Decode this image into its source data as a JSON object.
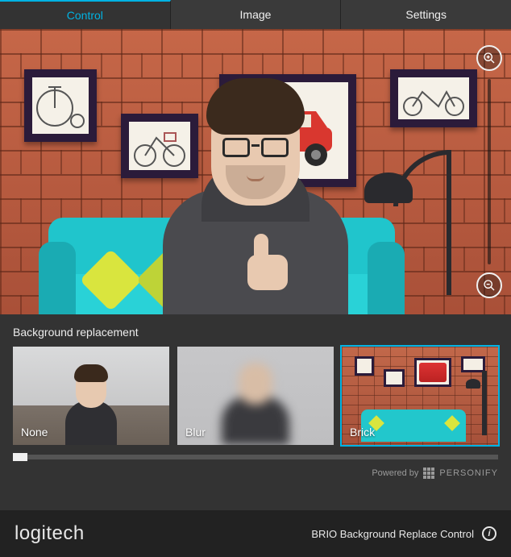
{
  "tabs": {
    "control": "Control",
    "image": "Image",
    "settings": "Settings",
    "active": "control"
  },
  "section": {
    "background_replacement_title": "Background replacement"
  },
  "bg_options": [
    {
      "id": "none",
      "label": "None",
      "selected": false
    },
    {
      "id": "blur",
      "label": "Blur",
      "selected": false
    },
    {
      "id": "brick",
      "label": "Brick",
      "selected": true
    }
  ],
  "powered_by": {
    "prefix": "Powered by",
    "brand": "PERSONIFY"
  },
  "footer": {
    "brand": "logitech",
    "product": "BRIO Background Replace Control"
  },
  "icons": {
    "zoom_in": "zoom-in-icon",
    "zoom_out": "zoom-out-icon",
    "info": "i"
  }
}
